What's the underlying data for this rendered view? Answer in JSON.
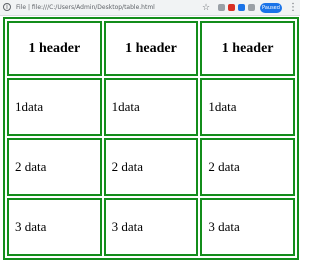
{
  "browser": {
    "info_icon": "i",
    "address": "File | file:///C:/Users/Admin/Desktop/table.html",
    "star_icon": "☆",
    "profile_label": "Paused",
    "menu_icon": "⋮"
  },
  "table": {
    "headers": [
      "1 header",
      "1 header",
      "1 header"
    ],
    "rows": [
      [
        "1data",
        "1data",
        "1data"
      ],
      [
        "2 data",
        "2 data",
        "2 data"
      ],
      [
        "3 data",
        "3 data",
        "3 data"
      ]
    ]
  },
  "colors": {
    "border": "#138d1b"
  }
}
